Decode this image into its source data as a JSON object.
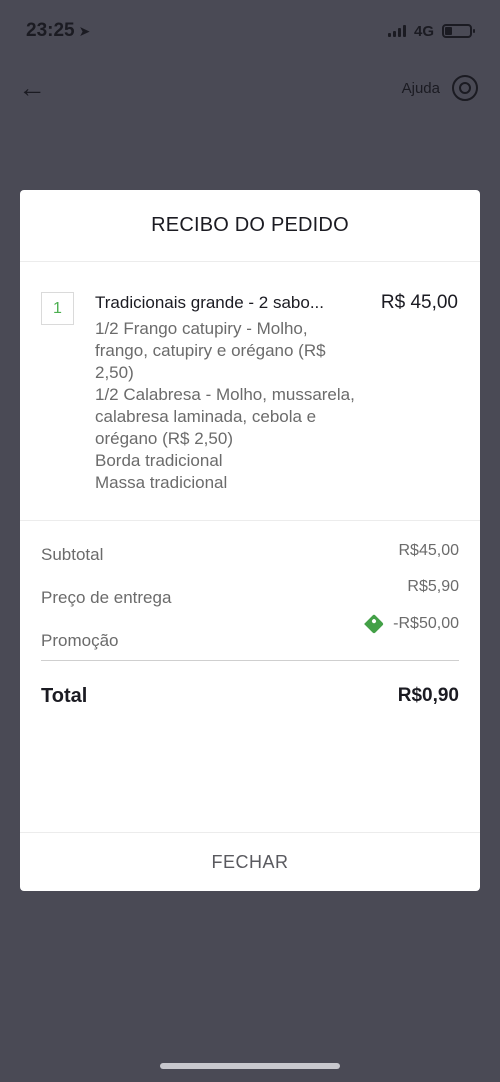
{
  "status_bar": {
    "time": "23:25",
    "network": "4G"
  },
  "header": {
    "help_label": "Ajuda"
  },
  "modal": {
    "title": "RECIBO DO PEDIDO",
    "item": {
      "quantity": "1",
      "name": "Tradicionais grande - 2 sabo...",
      "price": "R$ 45,00",
      "description": [
        "1/2 Frango catupiry - Molho, frango, catupiry e orégano (R$ 2,50)",
        "1/2 Calabresa - Molho, mussarela, calabresa laminada, cebola e orégano (R$ 2,50)",
        "Borda tradicional",
        "Massa tradicional"
      ]
    },
    "totals": {
      "subtotal_label": "Subtotal",
      "subtotal_value": "R$45,00",
      "delivery_label": "Preço de entrega",
      "delivery_value": "R$5,90",
      "promo_label": "Promoção",
      "promo_value": "-R$50,00",
      "total_label": "Total",
      "total_value": "R$0,90"
    },
    "close_label": "FECHAR"
  },
  "colors": {
    "accent_green": "#43a047",
    "overlay": "#4a4a55"
  }
}
